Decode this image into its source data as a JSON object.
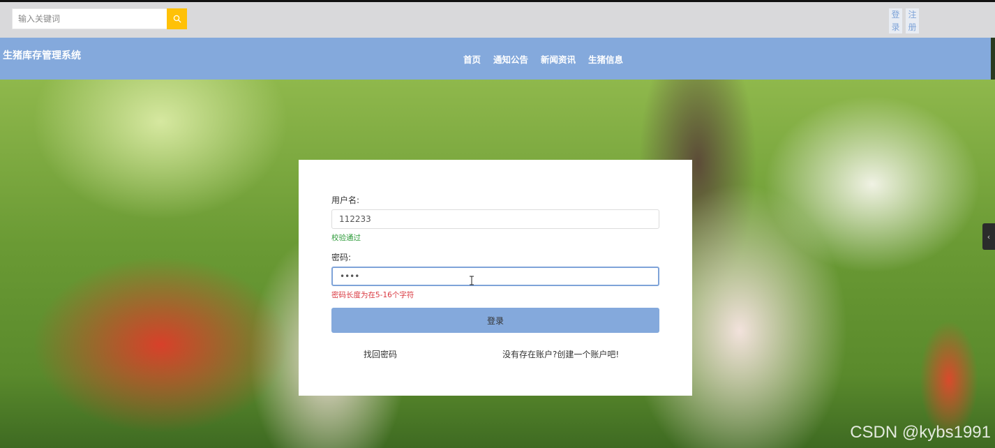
{
  "search": {
    "placeholder": "输入关键词"
  },
  "auth": {
    "login_label": "登录",
    "register_label": "注册"
  },
  "header": {
    "site_title": "生猪库存管理系统"
  },
  "nav": {
    "items": [
      "首页",
      "通知公告",
      "新闻资讯",
      "生猪信息"
    ]
  },
  "login_form": {
    "username_label": "用户名:",
    "username_value": "112233",
    "username_hint": "校验通过",
    "password_label": "密码:",
    "password_value": "••••",
    "password_error": "密码长度为在5-16个字符",
    "submit_label": "登录",
    "forgot_link": "找回密码",
    "create_link": "没有存在账户?创建一个账户吧!"
  },
  "side_toggle": {
    "glyph": "‹"
  },
  "watermark": "CSDN @kybs1991",
  "colors": {
    "brand": "#84a9dc",
    "search_button": "#ffc107",
    "ok": "#2e9b3a",
    "error": "#d9363e"
  },
  "icons": {
    "search_button": "search-icon",
    "text_caret": "text-cursor-icon"
  }
}
